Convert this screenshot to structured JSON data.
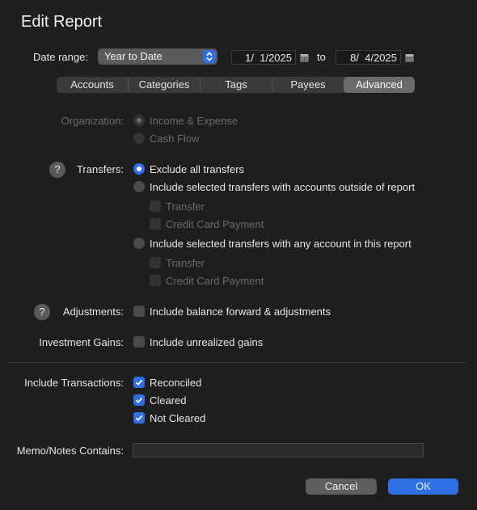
{
  "dialog": {
    "title": "Edit Report"
  },
  "date_range": {
    "label": "Date range:",
    "selected": "Year to Date",
    "start": "1/  1/2025",
    "to_label": "to",
    "end": "8/  4/2025"
  },
  "tabs": [
    {
      "label": "Accounts",
      "selected": false
    },
    {
      "label": "Categories",
      "selected": false
    },
    {
      "label": "Tags",
      "selected": false
    },
    {
      "label": "Payees",
      "selected": false
    },
    {
      "label": "Advanced",
      "selected": true
    }
  ],
  "organization": {
    "label": "Organization:",
    "options": [
      "Income & Expense",
      "Cash Flow"
    ],
    "selected": "Income & Expense",
    "enabled": false
  },
  "transfers": {
    "label": "Transfers:",
    "options": [
      "Exclude all transfers",
      "Include selected transfers with accounts outside of report",
      "Include selected transfers with any account in this report"
    ],
    "selected": "Exclude all transfers",
    "sub_outside": [
      "Transfer",
      "Credit Card Payment"
    ],
    "sub_inside": [
      "Transfer",
      "Credit Card Payment"
    ]
  },
  "adjustments": {
    "label": "Adjustments:",
    "checkbox": "Include balance forward & adjustments",
    "checked": false
  },
  "investment_gains": {
    "label": "Investment Gains:",
    "checkbox": "Include unrealized gains",
    "checked": false
  },
  "include_transactions": {
    "label": "Include Transactions:",
    "items": [
      {
        "label": "Reconciled",
        "checked": true
      },
      {
        "label": "Cleared",
        "checked": true
      },
      {
        "label": "Not Cleared",
        "checked": true
      }
    ]
  },
  "memo": {
    "label": "Memo/Notes Contains:",
    "value": ""
  },
  "buttons": {
    "cancel": "Cancel",
    "ok": "OK"
  },
  "help_glyph": "?",
  "icons": {
    "stepper": "up-down-chevron-icon",
    "calendar": "calendar-icon",
    "help": "question-icon",
    "check": "checkmark-icon"
  },
  "colors": {
    "accent": "#2f6fe4",
    "background": "#1e1e1e"
  }
}
